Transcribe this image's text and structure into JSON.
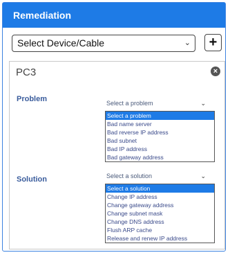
{
  "header": {
    "title": "Remediation"
  },
  "device_select": {
    "value": "Select Device/Cable"
  },
  "add_button": {
    "label": "+"
  },
  "device": {
    "name": "PC3",
    "close_label": "×",
    "problem": {
      "label": "Problem",
      "selected": "Select a problem",
      "options": [
        "Select a problem",
        "Bad name server",
        "Bad reverse IP address",
        "Bad subnet",
        "Bad IP address",
        "Bad gateway address"
      ]
    },
    "solution": {
      "label": "Solution",
      "selected": "Select a solution",
      "options": [
        "Select a solution",
        "Change IP address",
        "Change gateway address",
        "Change subnet mask",
        "Change DNS address",
        "Flush ARP cache",
        "Release and renew IP address"
      ]
    }
  }
}
